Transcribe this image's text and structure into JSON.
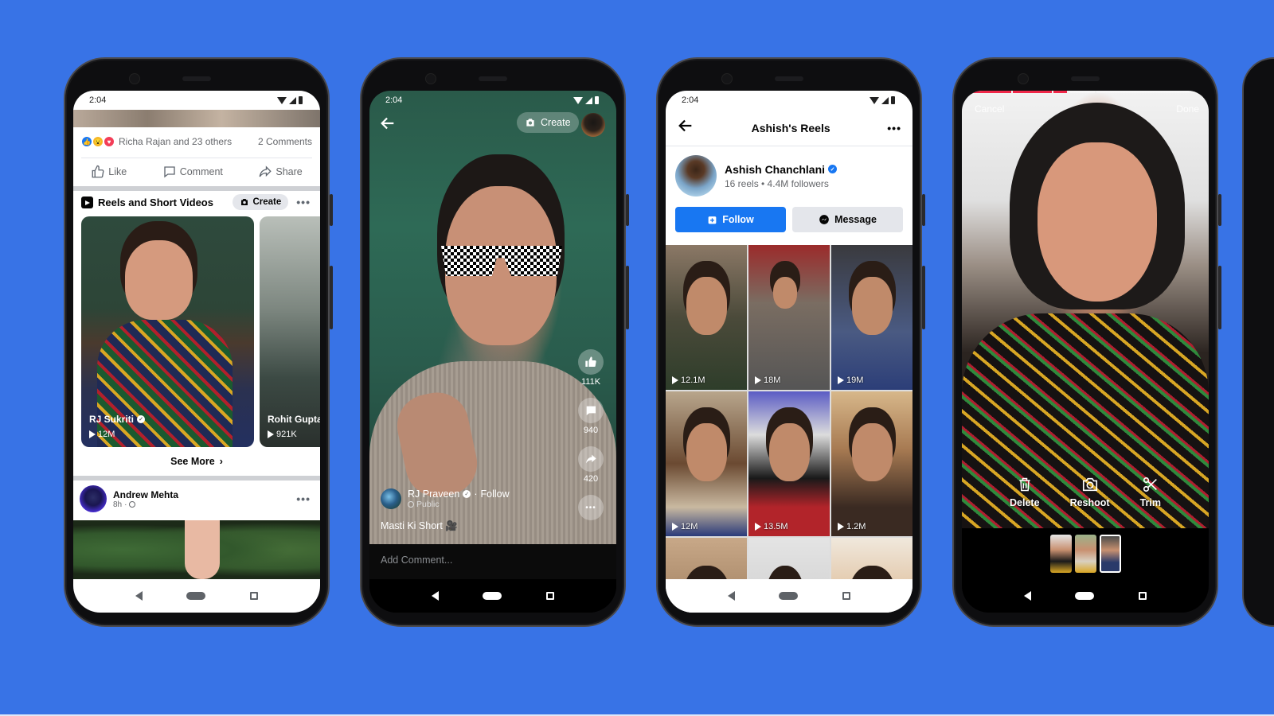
{
  "background_color": "#3873e6",
  "accent_colors": {
    "facebook_blue": "#1877f2",
    "record_red": "#f02849"
  },
  "phones": {
    "feed": {
      "status_time": "2:04",
      "reactions_text": "Richa Rajan and 23 others",
      "comments_count": "2 Comments",
      "actions": {
        "like": "Like",
        "comment": "Comment",
        "share": "Share"
      },
      "reels_section": {
        "title": "Reels and Short Videos",
        "create_label": "Create",
        "cards": [
          {
            "name": "RJ Sukriti",
            "verified": true,
            "views": "12M"
          },
          {
            "name": "Rohit Gupta",
            "verified": false,
            "views": "921K"
          }
        ],
        "see_more": "See More"
      },
      "post": {
        "author": "Andrew Mehta",
        "time": "8h",
        "privacy": "globe-icon"
      }
    },
    "reel_viewer": {
      "status_time": "2:04",
      "create_label": "Create",
      "likes": "111K",
      "comments": "940",
      "shares": "420",
      "author": "RJ Praveen",
      "verified": true,
      "follow_label": "Follow",
      "audience": "Public",
      "caption": "Masti Ki Short 🎥",
      "comment_placeholder": "Add Comment..."
    },
    "profile_reels": {
      "status_time": "2:04",
      "title": "Ashish's Reels",
      "name": "Ashish Chanchlani",
      "verified": true,
      "stats": "16 reels • 4.4M followers",
      "follow_label": "Follow",
      "message_label": "Message",
      "reels": [
        {
          "views": "12.1M"
        },
        {
          "views": "18M"
        },
        {
          "views": "19M"
        },
        {
          "views": "12M"
        },
        {
          "views": "13.5M"
        },
        {
          "views": "1.2M"
        },
        {
          "views": ""
        },
        {
          "views": ""
        },
        {
          "views": ""
        }
      ]
    },
    "editor": {
      "cancel_label": "Cancel",
      "done_label": "Done",
      "progress_segments_recorded": 3,
      "tools": {
        "delete": "Delete",
        "reshoot": "Reshoot",
        "trim": "Trim"
      },
      "clip_count": 3,
      "selected_clip": 3
    }
  }
}
